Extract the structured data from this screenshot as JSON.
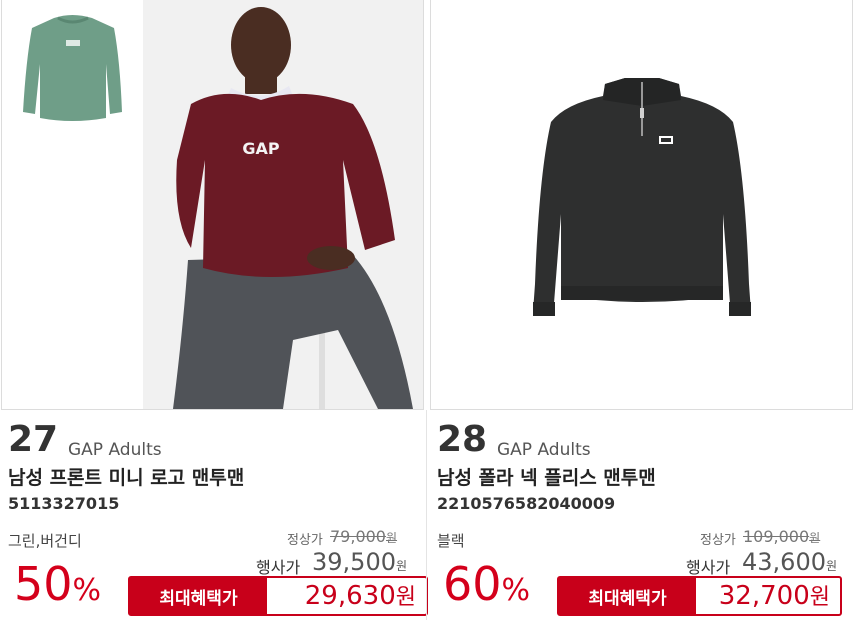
{
  "products": [
    {
      "number": "27",
      "brand": "GAP Adults",
      "name": "남성 프론트 미니 로고 맨투맨",
      "code": "5113327015",
      "colors": "그린,버건디",
      "regular_label": "정상가",
      "regular_price": "79,000",
      "regular_unit": "원",
      "sale_label": "행사가",
      "sale_price": "39,500",
      "sale_unit": "원",
      "discount": "50",
      "discount_unit": "%",
      "benefit_label": "최대혜택가",
      "benefit_price": "29,630",
      "benefit_unit": "원",
      "thumb_color": "#6f9e88",
      "shirt_color": "#6b1a25"
    },
    {
      "number": "28",
      "brand": "GAP Adults",
      "name": "남성 폴라 넥 플리스 맨투맨",
      "code": "2210576582040009",
      "colors": "블랙",
      "regular_label": "정상가",
      "regular_price": "109,000",
      "regular_unit": "원",
      "sale_label": "행사가",
      "sale_price": "43,600",
      "sale_unit": "원",
      "discount": "60",
      "discount_unit": "%",
      "benefit_label": "최대혜택가",
      "benefit_price": "32,700",
      "benefit_unit": "원",
      "shirt_color": "#2e2f2f"
    }
  ],
  "colors": {
    "accent": "#c8001a",
    "discount": "#d4001b"
  },
  "logo_text": "GAP"
}
